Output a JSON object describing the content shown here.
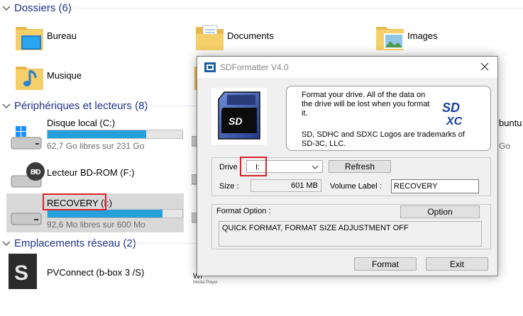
{
  "explorer": {
    "groups": {
      "folders": "Dossiers (6)",
      "devices": "Périphériques et lecteurs (8)",
      "network": "Emplacements réseau (2)"
    },
    "folders": [
      {
        "label": "Bureau"
      },
      {
        "label": "Documents"
      },
      {
        "label": "Images"
      },
      {
        "label": "Musique"
      }
    ],
    "drives": [
      {
        "label": "Disque local (C:)",
        "free": "62,7 Go libres sur 231 Go",
        "used_fraction": 0.73
      },
      {
        "label": "Lecteur BD-ROM (F:)"
      },
      {
        "label": "RECOVERY (I:)",
        "free": "92,6 Mo libres sur 600 Mo",
        "used_fraction": 0.85
      }
    ],
    "partial_labels": {
      "ubuntu": "buntu",
      "ubuntu_sub": "Go",
      "wmp": "Wi",
      "wmp_sub": "Media Player"
    },
    "network_items": [
      {
        "label": "PVConnect (b-box 3 /S)"
      }
    ]
  },
  "dialog": {
    "title": "SDFormatter V4.0",
    "info_line1": "Format your drive. All of the data on the drive will be lost when you format it.",
    "info_line2": "SD, SDHC and SDXC Logos are trademarks of SD-3C, LLC.",
    "logo_text": "SD",
    "logo_text2": "XC",
    "drive_label": "Drive :",
    "drive_value": "I:",
    "refresh_label": "Refresh",
    "size_label": "Size  :",
    "size_value": "601  MB",
    "volume_label_label": "Volume Label :",
    "volume_label_value": "RECOVERY",
    "format_option_label": "Format Option :",
    "option_button": "Option",
    "format_option_value": "QUICK FORMAT, FORMAT SIZE ADJUSTMENT OFF",
    "format_button": "Format",
    "exit_button": "Exit"
  },
  "colors": {
    "accent": "#26a0da",
    "group_header": "#1e3287",
    "highlight_box": "#d8232a"
  }
}
